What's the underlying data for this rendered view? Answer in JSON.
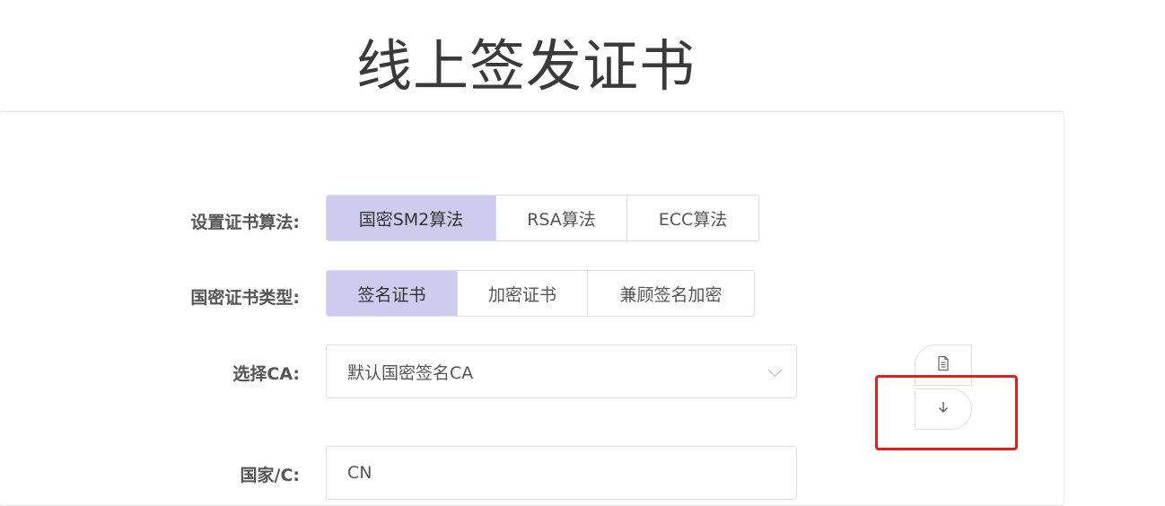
{
  "page": {
    "title": "线上签发证书"
  },
  "form": {
    "algorithm": {
      "label": "设置证书算法:",
      "options": [
        "国密SM2算法",
        "RSA算法",
        "ECC算法"
      ],
      "selected": "国密SM2算法"
    },
    "cert_type": {
      "label": "国密证书类型:",
      "options": [
        "签名证书",
        "加密证书",
        "兼顾签名加密"
      ],
      "selected": "签名证书"
    },
    "ca": {
      "label": "选择CA:",
      "value": "默认国密签名CA"
    },
    "country": {
      "label": "国家/C:",
      "value": "CN"
    }
  },
  "float_buttons": {
    "top_icon": "document-icon",
    "bottom_icon": "arrow-down-icon"
  },
  "colors": {
    "active_segment": "#cdccee",
    "highlight_border": "#e02020"
  }
}
